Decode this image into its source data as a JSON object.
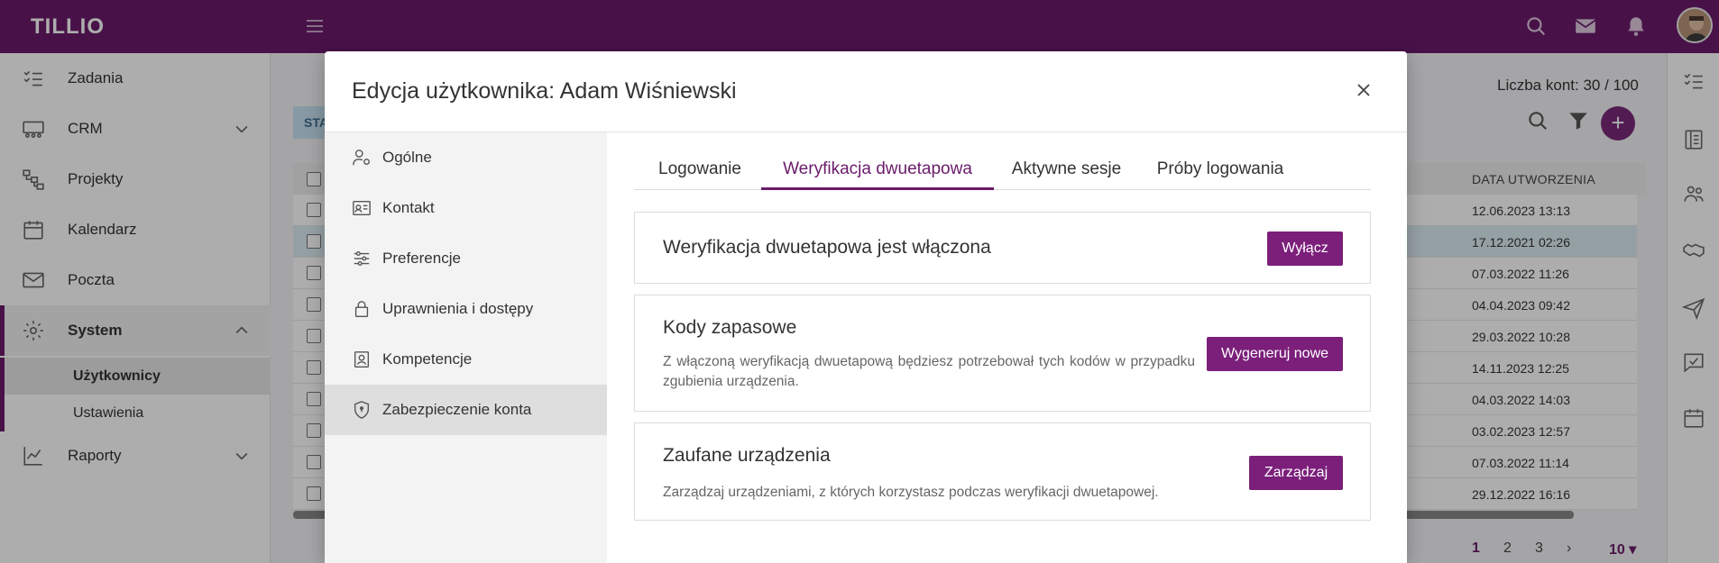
{
  "app": {
    "logo": "TILLIO"
  },
  "topbar": {
    "icons": [
      "menu-icon",
      "search-icon",
      "mail-icon",
      "bell-icon"
    ],
    "accent": "#6a1b6a"
  },
  "sidebar": {
    "items": [
      {
        "label": "Zadania"
      },
      {
        "label": "CRM"
      },
      {
        "label": "Projekty"
      },
      {
        "label": "Kalendarz"
      },
      {
        "label": "Poczta"
      },
      {
        "label": "System"
      },
      {
        "label": "Raporty"
      }
    ],
    "system_sub": [
      {
        "label": "Użytkownicy"
      },
      {
        "label": "Ustawienia"
      }
    ]
  },
  "content": {
    "account_count": "Liczba kont: 30 / 100",
    "status_chip": "STA",
    "date_header": "DATA UTWORZENIA",
    "dates": [
      "12.06.2023 13:13",
      "17.12.2021 02:26",
      "07.03.2022 11:26",
      "04.04.2023 09:42",
      "29.03.2022 10:28",
      "14.11.2023 12:25",
      "04.03.2022 14:03",
      "03.02.2023 12:57",
      "07.03.2022 11:14",
      "29.12.2022 16:16"
    ],
    "pages": [
      "1",
      "2",
      "3"
    ],
    "per_page": "10"
  },
  "modal": {
    "title": "Edycja użytkownika: Adam Wiśniewski",
    "nav": [
      {
        "label": "Ogólne"
      },
      {
        "label": "Kontakt"
      },
      {
        "label": "Preferencje"
      },
      {
        "label": "Uprawnienia i dostępy"
      },
      {
        "label": "Kompetencje"
      },
      {
        "label": "Zabezpieczenie konta"
      }
    ],
    "tabs": [
      {
        "label": "Logowanie"
      },
      {
        "label": "Weryfikacja dwuetapowa"
      },
      {
        "label": "Aktywne sesje"
      },
      {
        "label": "Próby logowania"
      }
    ],
    "cards": {
      "status": {
        "title": "Weryfikacja dwuetapowa jest włączona",
        "button": "Wyłącz"
      },
      "backup": {
        "title": "Kody zapasowe",
        "desc": "Z włączoną weryfikacją dwuetapową będziesz potrzebował tych kodów w przypadku zgubienia urządzenia.",
        "button": "Wygeneruj nowe"
      },
      "devices": {
        "title": "Zaufane urządzenia",
        "desc": "Zarządzaj urządzeniami, z których korzystasz podczas weryfikacji dwuetapowej.",
        "button": "Zarządzaj"
      }
    }
  }
}
